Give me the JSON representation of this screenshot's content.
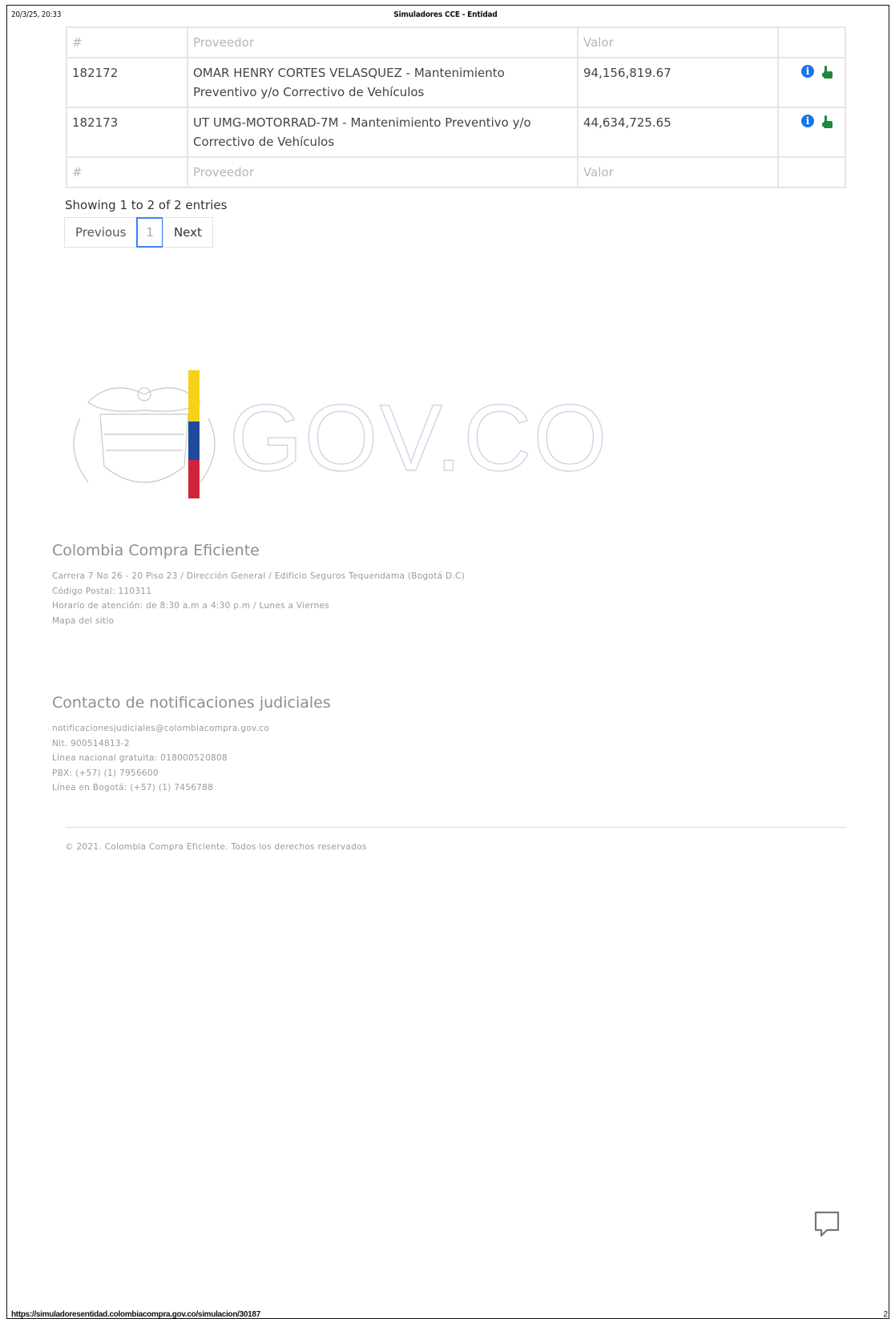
{
  "print_header": {
    "datetime": "20/3/25, 20:33",
    "title": "Simuladores CCE - Entidad"
  },
  "table": {
    "headers": [
      "#",
      "Proveedor",
      "Valor",
      ""
    ],
    "rows": [
      {
        "id": "182172",
        "proveedor": "OMAR HENRY CORTES VELASQUEZ - Mantenimiento Preventivo y/o Correctivo de Vehículos",
        "valor": "94,156,819.67"
      },
      {
        "id": "182173",
        "proveedor": "UT UMG-MOTORRAD-7M - Mantenimiento Preventivo y/o Correctivo de Vehículos",
        "valor": "44,634,725.65"
      }
    ],
    "footer_headers": [
      "#",
      "Proveedor",
      "Valor",
      ""
    ]
  },
  "entries_info": "Showing 1 to 2 of 2 entries",
  "pagination": {
    "previous": "Previous",
    "current": "1",
    "next": "Next"
  },
  "logo": {
    "text": "GOV.CO",
    "flag_colors": [
      "#f7d117",
      "#1c4a9c",
      "#d0233a"
    ]
  },
  "footer": {
    "org_title": "Colombia Compra Eficiente",
    "address": "Carrera 7 No 26 - 20 Piso 23 / Dirección General / Edificio Seguros Tequendama (Bogotá D.C)",
    "postal": "Código Postal: 110311",
    "hours": "Horario de atención: de 8:30 a.m a 4:30 p.m / Lunes a Viernes",
    "sitemap": "Mapa del sitio",
    "judicial_title": "Contacto de notificaciones judiciales",
    "email": "notificacionesjudiciales@colombiacompra.gov.co",
    "nit": "Nit. 900514813-2",
    "national_line": "Línea nacional gratuita: 018000520808",
    "pbx": "PBX: (+57) (1) 7956600",
    "bogota_line": "Línea en Bogotá: (+57) (1) 7456788",
    "copyright": "© 2021. Colombia Compra Eficiente. Todos los derechos reservados"
  },
  "print_footer": {
    "url": "https://simuladoresentidad.colombiacompra.gov.co/simulacion/30187",
    "page": "2"
  }
}
